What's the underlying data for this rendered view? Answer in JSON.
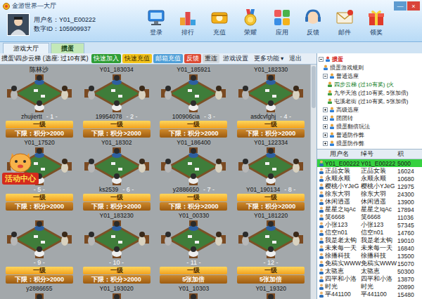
{
  "window": {
    "title": "金游世界—大厅",
    "controls": [
      "—",
      "×"
    ]
  },
  "user": {
    "username_label": "用户名：",
    "username": "Y01_E00222",
    "id_label": "数字ID：",
    "id": "105909937"
  },
  "nav": [
    {
      "label": "登录"
    },
    {
      "label": "排行"
    },
    {
      "label": "充值"
    },
    {
      "label": "荣耀"
    },
    {
      "label": "应用"
    },
    {
      "label": "反馈"
    },
    {
      "label": "邮件"
    },
    {
      "label": "领奖"
    }
  ],
  "tabs": [
    {
      "label": "游戏大厅",
      "selected": false
    },
    {
      "label": "掼蛋",
      "selected": true
    }
  ],
  "toolbar": {
    "path": "掼蛋\\四步云梯 (选座: 过10有奖)",
    "buttons": [
      {
        "label": "快速加入",
        "kind": "green"
      },
      {
        "label": "快速充值",
        "kind": "yellow"
      },
      {
        "label": "邮箱充值",
        "kind": "blue"
      },
      {
        "label": "反馈",
        "kind": "red"
      },
      {
        "label": "重连",
        "kind": "grey"
      },
      {
        "label": "游戏设置",
        "kind": "plain"
      },
      {
        "label": "更多功能 ▾",
        "kind": "plain"
      },
      {
        "label": "退出",
        "kind": "plain"
      }
    ]
  },
  "tables": [
    {
      "kind": "full",
      "number": "- 1 -",
      "top": "陈林沙",
      "bottom": "zhujiertt",
      "level": "一级",
      "limit": "下限：积分>2000"
    },
    {
      "kind": "full",
      "number": "- 2 -",
      "top": "Y01_183034",
      "bottom": "19954078",
      "level": "一级",
      "limit": "下限：积分>2000"
    },
    {
      "kind": "full",
      "number": "- 3 -",
      "top": "Y01_185921",
      "bottom": "100906cia",
      "level": "一级",
      "limit": "下限：积分>2000"
    },
    {
      "kind": "full",
      "number": "- 4 -",
      "top": "Y01_182330",
      "bottom": "asdcvfghj",
      "level": "一级",
      "limit": "下限：积分>2000"
    },
    {
      "kind": "full",
      "number": "- 5 -",
      "top": "Y01_17520",
      "bottom": "",
      "level": "一级",
      "limit": "下限：积分>2000"
    },
    {
      "kind": "full",
      "number": "- 6 -",
      "top": "Y01_18302",
      "bottom": "ks2539",
      "level": "一级",
      "limit": "下限：积分>2000"
    },
    {
      "kind": "full",
      "number": "- 7 -",
      "top": "Y01_186400",
      "bottom": "y2886650",
      "level": "一级",
      "limit": "下限：积分>2000"
    },
    {
      "kind": "full",
      "number": "- 8 -",
      "top": "Y01_122334",
      "bottom": "Y01_190134",
      "level": "一级",
      "limit": "下限：积分>2000"
    },
    {
      "kind": "full",
      "number": "- 9 -",
      "top": "",
      "bottom": "",
      "level": "一级",
      "limit": "下限：积分>2000"
    },
    {
      "kind": "full",
      "number": "- 10 -",
      "top": "Y01_183230",
      "bottom": "",
      "level": "一级",
      "limit": "下限：积分>2000"
    },
    {
      "kind": "full",
      "number": "- 11 -",
      "top": "Y01_00330",
      "bottom": "",
      "level": "一级",
      "limit": "5张加倍"
    },
    {
      "kind": "full",
      "number": "- 12 -",
      "top": "Y01_181220",
      "bottom": "",
      "level": "一级",
      "limit": "5张加倍"
    },
    {
      "kind": "partial",
      "top": "y2886655"
    },
    {
      "kind": "partial",
      "top": "Y01_193020"
    },
    {
      "kind": "partial",
      "top": "Y01_10303"
    },
    {
      "kind": "partial",
      "top": "Y01_19320"
    }
  ],
  "activity": {
    "label": "活动中心"
  },
  "tree": [
    {
      "label": "掼蛋",
      "depth": 0,
      "kind": "folder",
      "expanded": true,
      "selected": false
    },
    {
      "label": "掼蛋游戏规则",
      "depth": 1,
      "kind": "leaf",
      "expanded": false,
      "selected": false
    },
    {
      "label": "普通选座",
      "depth": 1,
      "kind": "folder",
      "expanded": true,
      "selected": false
    },
    {
      "label": "四步云梯 (过10有奖) (火",
      "depth": 2,
      "kind": "leaf",
      "expanded": false,
      "selected": true
    },
    {
      "label": "九华天池 (过10有奖, 5张加倍)",
      "depth": 2,
      "kind": "leaf",
      "expanded": false,
      "selected": false
    },
    {
      "label": "屯溪老街 (过10有奖, 5张加倍)",
      "depth": 2,
      "kind": "leaf",
      "expanded": false,
      "selected": false
    },
    {
      "label": "高级选座",
      "depth": 1,
      "kind": "folder",
      "expanded": false,
      "selected": false
    },
    {
      "label": "团团转",
      "depth": 1,
      "kind": "folder",
      "expanded": false,
      "selected": false
    },
    {
      "label": "掼蛋翻倍玩法",
      "depth": 1,
      "kind": "folder",
      "expanded": false,
      "selected": false
    },
    {
      "label": "普通防作弊",
      "depth": 1,
      "kind": "folder",
      "expanded": false,
      "selected": false
    },
    {
      "label": "掼蛋防作弊",
      "depth": 1,
      "kind": "folder",
      "expanded": false,
      "selected": false
    }
  ],
  "user_list": {
    "columns": [
      "用户名",
      "绰号",
      "积"
    ],
    "rows": [
      {
        "name": "Y01_E00222",
        "nick": "Y01_E00222",
        "score": "5000",
        "selected": true
      },
      {
        "name": "正品女装",
        "nick": "正品女装",
        "score": "16024",
        "selected": false
      },
      {
        "name": "永顺永顺",
        "nick": "永顺永顺",
        "score": "10680",
        "selected": false
      },
      {
        "name": "樱桃小YJeG",
        "nick": "樱桃小YJeG",
        "score": "12975",
        "selected": false
      },
      {
        "name": "徐东大羽",
        "nick": "徐东大羽",
        "score": "24300",
        "selected": false
      },
      {
        "name": "休闲逍遥",
        "nick": "休闲逍遥",
        "score": "13900",
        "selected": false
      },
      {
        "name": "星星之IqAc",
        "nick": "星星之IqAc",
        "score": "17894",
        "selected": false
      },
      {
        "name": "笑6668",
        "nick": "笑6668",
        "score": "11036",
        "selected": false
      },
      {
        "name": "小张123",
        "nick": "小张123",
        "score": "57345",
        "selected": false
      },
      {
        "name": "信空n01",
        "nick": "信空n01",
        "score": "14760",
        "selected": false
      },
      {
        "name": "我是老太钩",
        "nick": "我是老太钩",
        "score": "19010",
        "selected": false
      },
      {
        "name": "未来每一天",
        "nick": "未来每一天",
        "score": "16840",
        "selected": false
      },
      {
        "name": "徐播科技",
        "nick": "徐播科技",
        "score": "13500",
        "selected": false
      },
      {
        "name": "免稿实WWW",
        "nick": "免稿实WWW",
        "score": "15070",
        "selected": false
      },
      {
        "name": "太骆恵",
        "nick": "太骆恵",
        "score": "50300",
        "selected": false
      },
      {
        "name": "四平和小洛",
        "nick": "四平和小洛",
        "score": "13870",
        "selected": false
      },
      {
        "name": "时光",
        "nick": "时光",
        "score": "20890",
        "selected": false
      },
      {
        "name": "平441100",
        "nick": "平441100",
        "score": "15480",
        "selected": false
      }
    ]
  }
}
